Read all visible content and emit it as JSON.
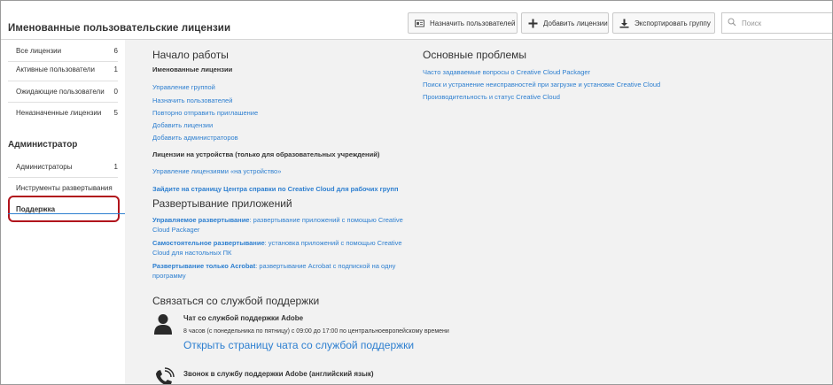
{
  "header": {
    "title": "Именованные пользовательские лицензии",
    "buttons": {
      "assign_users": "Назначить пользователей",
      "add_licenses": "Добавить лицензии",
      "export_group": "Экспортировать группу"
    },
    "search_placeholder": "Поиск"
  },
  "sidebar": {
    "items": [
      {
        "label": "Все лицензии",
        "count": "6"
      },
      {
        "label": "Активные пользователи",
        "count": "1"
      },
      {
        "label": "Ожидающие пользователи",
        "count": "0"
      },
      {
        "label": "Неназначенные лицензии",
        "count": "5"
      }
    ],
    "admin_heading": "Администратор",
    "admin_items": [
      {
        "label": "Администраторы",
        "count": "1"
      },
      {
        "label": "Инструменты развертывания",
        "count": ""
      },
      {
        "label": "Поддержка",
        "count": ""
      }
    ],
    "highlight_color": "#b1141c"
  },
  "getting_started": {
    "heading": "Начало работы",
    "named_licenses_sub": "Именованные лицензии",
    "named_links": [
      "Управление группой",
      "Назначить пользователей",
      "Повторно отправить приглашение",
      "Добавить лицензии",
      "Добавить администраторов"
    ],
    "device_sub": "Лицензии на устройства (только для образовательных учреждений)",
    "device_link": "Управление лицензиями «на устройство»",
    "help_center_link": "Зайдите на страницу Центра справки по Creative Cloud для рабочих групп"
  },
  "main_issues": {
    "heading": "Основные проблемы",
    "links": [
      "Часто задаваемые вопросы о Creative Cloud Packager",
      "Поиск и устранение неисправностей при загрузке и установке Creative Cloud",
      "Производительность и статус Creative Cloud"
    ]
  },
  "deployment": {
    "heading": "Развертывание приложений",
    "items": [
      {
        "bold": "Управляемое развертывание",
        "rest": ": развертывание приложений с помощью Creative Cloud Packager"
      },
      {
        "bold": "Самостоятельное развертывание",
        "rest": ": установка приложений с помощью Creative Cloud для настольных ПК"
      },
      {
        "bold": "Развертывание только Acrobat",
        "rest": ": развертывание Acrobat с подпиской на одну программу"
      }
    ]
  },
  "contact": {
    "heading": "Связаться со службой поддержки",
    "chat_title": "Чат со службой поддержки Adobe",
    "chat_hours": "8 часов (с понедельника по пятницу) с 09:00 до 17:00 по центральноевропейскому времени",
    "chat_link": "Открыть страницу чата со службой поддержки",
    "phone_title": "Звонок в службу поддержки Adobe (английский язык)"
  },
  "colors": {
    "link": "#2d7fd0",
    "main_bg": "#f2f2f2"
  }
}
